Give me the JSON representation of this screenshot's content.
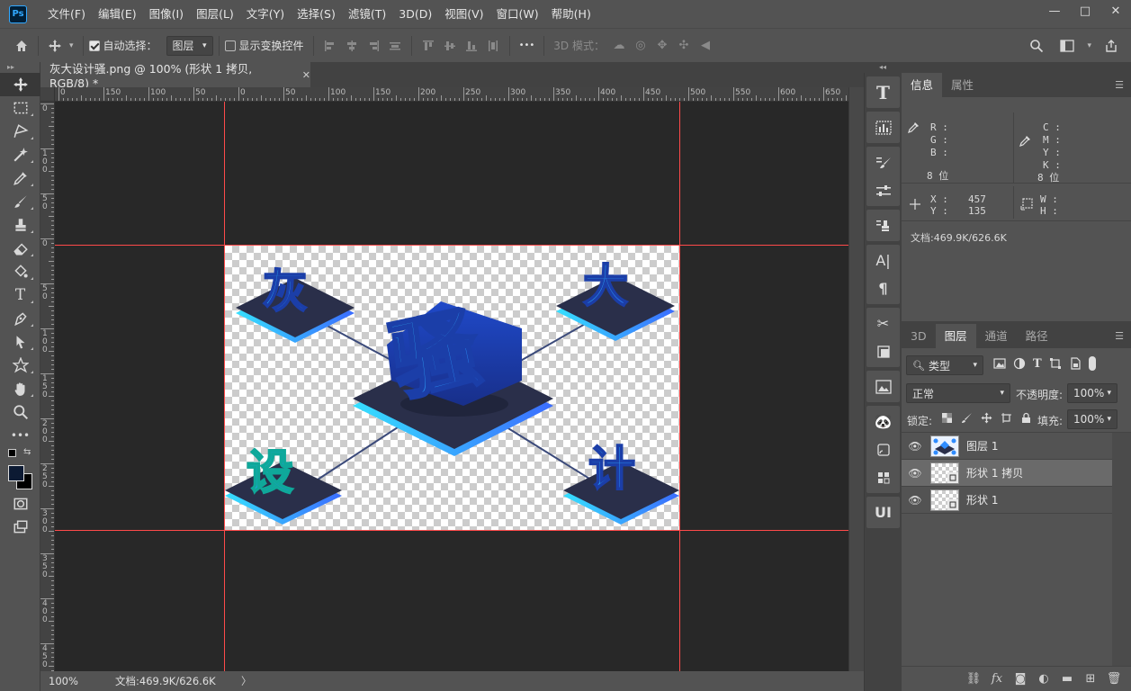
{
  "app": {
    "logo": "Ps"
  },
  "menu": [
    "文件(F)",
    "编辑(E)",
    "图像(I)",
    "图层(L)",
    "文字(Y)",
    "选择(S)",
    "滤镜(T)",
    "3D(D)",
    "视图(V)",
    "窗口(W)",
    "帮助(H)"
  ],
  "window_controls": {
    "minimize": "—",
    "maximize": "□",
    "close": "✕"
  },
  "options": {
    "auto_select_label": "自动选择：",
    "auto_select_checked": true,
    "auto_select_target": "图层",
    "show_transform_label": "显示变换控件",
    "show_transform_checked": false,
    "more": "•••",
    "mode_3d_label": "3D 模式："
  },
  "document": {
    "tab_title": "灰大设计骚.png @ 100% (形状 1 拷贝, RGB/8) *",
    "close": "✕",
    "zoom": "100%",
    "doc_size": "文档:469.9K/626.6K",
    "status_arrow": "〉"
  },
  "rulers": {
    "h_labels": [
      "0",
      "150",
      "100",
      "50",
      "0",
      "50",
      "100",
      "150",
      "200",
      "250",
      "300",
      "350",
      "400",
      "450",
      "500",
      "550",
      "600",
      "650"
    ],
    "v_labels": [
      "0",
      "100",
      "50",
      "0",
      "50",
      "100",
      "150",
      "200",
      "250",
      "300",
      "350",
      "400",
      "450"
    ]
  },
  "artwork": {
    "main_char": "骚",
    "corner_chars": [
      "灰",
      "大",
      "设",
      "计"
    ],
    "colors": {
      "tile_top": "#2a2f4a",
      "tile_edge": "#33c2ff",
      "char_light": "#2fb6ff",
      "char_dark": "#1e4fd8",
      "guide": "#ff4a4a",
      "line": "#3b4a7a"
    }
  },
  "info_panel": {
    "tabs": [
      "信息",
      "属性"
    ],
    "rgb_labels": [
      "R :",
      "G :",
      "B :"
    ],
    "cmyk_labels": [
      "C :",
      "M :",
      "Y :",
      "K :"
    ],
    "bits_left": "8 位",
    "bits_right": "8 位",
    "x_label": "X :",
    "y_label": "Y :",
    "x_value": "457",
    "y_value": "135",
    "w_label": "W :",
    "h_label": "H :",
    "doc_size": "文档:469.9K/626.6K"
  },
  "layers_panel": {
    "tabs": [
      "3D",
      "图层",
      "通道",
      "路径"
    ],
    "filter_kind": "类型",
    "blend_mode": "正常",
    "opacity_label": "不透明度:",
    "opacity_value": "100%",
    "lock_label": "锁定:",
    "fill_label": "填充:",
    "fill_value": "100%",
    "layers": [
      {
        "name": "图层 1",
        "visible": true,
        "selected": false
      },
      {
        "name": "形状 1 拷贝",
        "visible": true,
        "selected": true
      },
      {
        "name": "形状 1",
        "visible": true,
        "selected": false
      }
    ],
    "footer_icons": [
      "link-icon",
      "fx-icon",
      "mask-icon",
      "adjustment-icon",
      "folder-icon",
      "new-layer-icon",
      "trash-icon"
    ],
    "fx": "fx"
  },
  "icon_column": {
    "ui_label": "UI"
  }
}
